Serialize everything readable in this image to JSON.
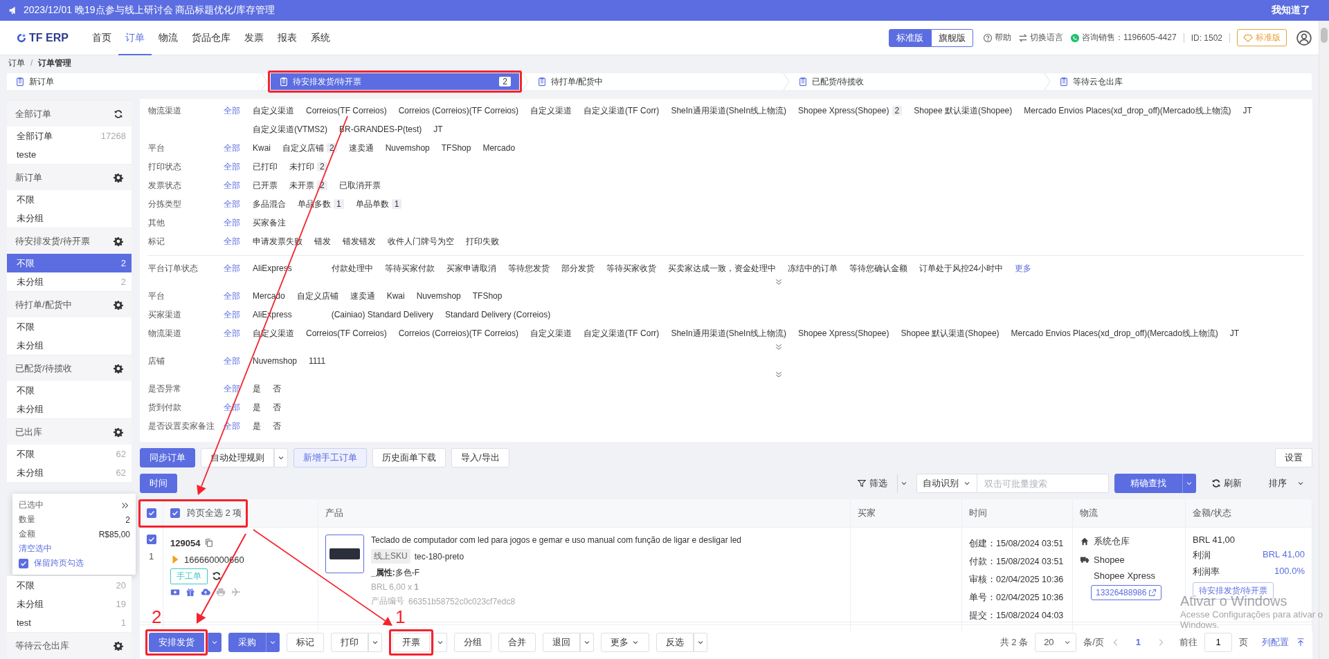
{
  "announcement": {
    "text": "2023/12/01 晚19点参与线上研讨会 商品标题优化/库存管理",
    "dismiss": "我知道了"
  },
  "nav": {
    "logo": "TF ERP",
    "items": [
      {
        "label": "首页",
        "selected": false
      },
      {
        "label": "订单",
        "selected": true
      },
      {
        "label": "物流",
        "selected": false
      },
      {
        "label": "货品仓库",
        "selected": false
      },
      {
        "label": "发票",
        "selected": false
      },
      {
        "label": "报表",
        "selected": false
      },
      {
        "label": "系统",
        "selected": false
      }
    ],
    "editions": [
      {
        "label": "标准版",
        "selected": true
      },
      {
        "label": "旗舰版",
        "selected": false
      }
    ],
    "help": "帮助",
    "language": "切换语言",
    "consult": "咨询销售：1196605-4427",
    "account_id": "ID: 1502",
    "plan": "标准版"
  },
  "breadcrumb": {
    "items": [
      "订单",
      "订单管理"
    ],
    "separator": "/"
  },
  "steps": [
    {
      "label": "新订单",
      "selected": false,
      "highlighted": false
    },
    {
      "label": "待安排发货/待开票",
      "count": "2",
      "selected": true,
      "highlighted": true
    },
    {
      "label": "待打单/配货中",
      "selected": false,
      "highlighted": false
    },
    {
      "label": "已配货/待揽收",
      "selected": false,
      "highlighted": false
    },
    {
      "label": "等待云仓出库",
      "selected": false,
      "highlighted": false
    }
  ],
  "sidebar": {
    "groups": [
      {
        "kind": "all",
        "title": "全部订单",
        "items": [
          {
            "label": "全部订单",
            "count": "17268",
            "selected": false
          },
          {
            "label": "teste",
            "selected": false
          }
        ]
      },
      {
        "kind": "status",
        "title": "新订单",
        "items": [
          {
            "label": "不限",
            "selected": false
          },
          {
            "label": "未分组",
            "selected": false
          }
        ]
      },
      {
        "kind": "status",
        "title": "待安排发货/待开票",
        "items": [
          {
            "label": "不限",
            "count": "2",
            "selected": true
          },
          {
            "label": "未分组",
            "count": "2",
            "selected": false
          }
        ]
      },
      {
        "kind": "status",
        "title": "待打单/配货中",
        "items": [
          {
            "label": "不限",
            "selected": false
          },
          {
            "label": "未分组",
            "selected": false
          }
        ]
      },
      {
        "kind": "status",
        "title": "已配货/待揽收",
        "items": [
          {
            "label": "不限",
            "selected": false
          },
          {
            "label": "未分组",
            "selected": false
          }
        ]
      },
      {
        "kind": "status",
        "title": "已出库",
        "items": [
          {
            "label": "不限",
            "count": "62",
            "selected": false
          },
          {
            "label": "未分组",
            "count": "62",
            "selected": false
          }
        ]
      },
      {
        "kind": "selection",
        "title": "已选中",
        "rows": [
          {
            "label": "数量",
            "value": "2"
          },
          {
            "label": "金额",
            "value": "R$85,00"
          }
        ],
        "clear": "清空选中",
        "keep": {
          "label": "保留跨页勾选",
          "checked": true
        }
      },
      {
        "kind": "status",
        "items": [
          {
            "label": "不限",
            "count": "20",
            "selected": false
          },
          {
            "label": "未分组",
            "count": "19",
            "selected": false
          },
          {
            "label": "test",
            "count": "1",
            "selected": false
          }
        ]
      },
      {
        "kind": "status",
        "title": "等待云仓出库"
      }
    ]
  },
  "filters": {
    "sections": [
      {
        "rows": [
          {
            "label": "物流渠道",
            "all": "全部",
            "options": [
              {
                "label": "自定义渠道"
              },
              {
                "label": "Correios(TF Correios)"
              },
              {
                "label": "Correios (Correios)(TF Correios)"
              },
              {
                "label": "自定义渠道"
              },
              {
                "label": "自定义渠道(TF Corr)"
              },
              {
                "label": "SheIn通用渠道(SheIn线上物流)"
              },
              {
                "label": "Shopee Xpress(Shopee)",
                "count": "2"
              },
              {
                "label": "Shopee 默认渠道(Shopee)"
              },
              {
                "label": "Mercado Envios Places(xd_drop_off)(Mercado线上物流)"
              },
              {
                "label": "JT"
              },
              {
                "label": "自定义渠道(VTMS2)"
              },
              {
                "label": "BR-GRANDES-P(test)"
              },
              {
                "label": "JT"
              }
            ]
          },
          {
            "label": "平台",
            "all": "全部",
            "options": [
              {
                "label": "Kwai"
              },
              {
                "label": "自定义店铺",
                "count": "2"
              },
              {
                "label": "速卖通"
              },
              {
                "label": "Nuvemshop"
              },
              {
                "label": "TFShop"
              },
              {
                "label": "Mercado"
              }
            ]
          },
          {
            "label": "打印状态",
            "all": "全部",
            "options": [
              {
                "label": "已打印"
              },
              {
                "label": "未打印",
                "count": "2"
              }
            ]
          },
          {
            "label": "发票状态",
            "all": "全部",
            "options": [
              {
                "label": "已开票"
              },
              {
                "label": "未开票",
                "count": "2"
              },
              {
                "label": "已取消开票"
              }
            ]
          },
          {
            "label": "分拣类型",
            "all": "全部",
            "options": [
              {
                "label": "多品混合"
              },
              {
                "label": "单品多数",
                "count": "1"
              },
              {
                "label": "单品单数",
                "count": "1"
              }
            ]
          },
          {
            "label": "其他",
            "all": "全部",
            "options": [
              {
                "label": "买家备注"
              }
            ]
          },
          {
            "label": "标记",
            "all": "全部",
            "options": [
              {
                "label": "申请发票失败"
              },
              {
                "label": "错发"
              },
              {
                "label": "错发错发"
              },
              {
                "label": "收件人门牌号为空"
              },
              {
                "label": "打印失败"
              }
            ]
          }
        ]
      },
      {
        "rows": [
          {
            "label": "平台订单状态",
            "all": "全部",
            "expandable": true,
            "more": "更多",
            "options": [
              {
                "label": "AliExpress",
                "kind": "group"
              },
              {
                "label": "付款处理中",
                "kind": "option"
              },
              {
                "label": "等待买家付款",
                "kind": "option"
              },
              {
                "label": "买家申请取消",
                "kind": "option"
              },
              {
                "label": "等待您发货",
                "kind": "option"
              },
              {
                "label": "部分发货",
                "kind": "option"
              },
              {
                "label": "等待买家收货",
                "kind": "option"
              },
              {
                "label": "买卖家达成一致，资金处理中",
                "kind": "option"
              },
              {
                "label": "冻结中的订单",
                "kind": "option"
              },
              {
                "label": "等待您确认金额",
                "kind": "option"
              },
              {
                "label": "订单处于风控24小时中",
                "kind": "option"
              }
            ]
          },
          {
            "label": "平台",
            "all": "全部",
            "expandable": false,
            "options": [
              {
                "label": "Mercado"
              },
              {
                "label": "自定义店铺"
              },
              {
                "label": "速卖通"
              },
              {
                "label": "Kwai"
              },
              {
                "label": "Nuvemshop"
              },
              {
                "label": "TFShop"
              }
            ]
          },
          {
            "label": "买家渠道",
            "all": "全部",
            "expandable": false,
            "options": [
              {
                "label": "AliExpress",
                "kind": "group"
              },
              {
                "label": "(Cainiao) Standard Delivery",
                "kind": "option"
              },
              {
                "label": "Standard Delivery (Correios)",
                "kind": "option"
              }
            ]
          },
          {
            "label": "物流渠道",
            "all": "全部",
            "expandable": true,
            "options": [
              {
                "label": "自定义渠道"
              },
              {
                "label": "Correios(TF Correios)"
              },
              {
                "label": "Correios (Correios)(TF Correios)"
              },
              {
                "label": "自定义渠道"
              },
              {
                "label": "自定义渠道(TF Corr)"
              },
              {
                "label": "SheIn通用渠道(SheIn线上物流)"
              },
              {
                "label": "Shopee Xpress(Shopee)"
              },
              {
                "label": "Shopee 默认渠道(Shopee)"
              },
              {
                "label": "Mercado Envios Places(xd_drop_off)(Mercado线上物流)"
              },
              {
                "label": "JT"
              }
            ]
          },
          {
            "label": "店铺",
            "all": "全部",
            "expandable": true,
            "options": [
              {
                "label": "Nuvemshop"
              },
              {
                "label": "1111"
              }
            ]
          },
          {
            "label": "是否异常",
            "all": "全部",
            "expandable": false,
            "options": [
              {
                "label": "是"
              },
              {
                "label": "否"
              }
            ]
          },
          {
            "label": "货到付款",
            "all": "全部",
            "expandable": false,
            "options": [
              {
                "label": "是"
              },
              {
                "label": "否"
              }
            ]
          },
          {
            "label": "是否设置卖家备注",
            "all": "全部",
            "expandable": false,
            "options": [
              {
                "label": "是"
              },
              {
                "label": "否"
              }
            ]
          }
        ]
      }
    ]
  },
  "toolbar": {
    "left": [
      {
        "label": "同步订单",
        "kind": "primary",
        "split": false
      },
      {
        "label": "自动处理规则",
        "kind": "default",
        "split": true
      },
      {
        "label": "新增手工订单",
        "kind": "light",
        "split": false
      },
      {
        "label": "历史面单下载",
        "kind": "default",
        "split": false
      },
      {
        "label": "导入/导出",
        "kind": "default",
        "split": false
      }
    ],
    "right": [
      {
        "label": "设置",
        "kind": "default",
        "split": false
      }
    ]
  },
  "searchbar": {
    "left": [
      {
        "label": "时间",
        "kind": "primary",
        "split": false
      }
    ],
    "filter": "筛选",
    "mode": "自动识别",
    "placeholder": "双击可批量搜索",
    "exact": "精确查找",
    "refresh": "刷新",
    "sort": "排序"
  },
  "table": {
    "header_checked": true,
    "select_all": {
      "checked": true,
      "label": "跨页全选 2 项",
      "highlighted": true
    },
    "columns": [
      "产品",
      "买家",
      "时间",
      "物流",
      "金额/状态"
    ],
    "rows": [
      {
        "checked": true,
        "index": "1",
        "order_no": "129054",
        "platform_order": "166660000660",
        "tag": "手工单",
        "product": {
          "title": "Teclado de computador com led para jogos e gemar e uso manual com função de ligar e desligar led",
          "sku_label": "线上SKU",
          "sku": "tec-180-preto",
          "attribute": "**_属性:**多色-F",
          "price": "BRL 6,00 x **1**",
          "code_label": "产品编号",
          "code": "66351b58752c0c023cf7edc8"
        },
        "times": [
          "创建：15/08/2024 03:51",
          "付款：15/08/2024 03:51",
          "审核：02/04/2025 10:36",
          "单号：02/04/2025 10:36",
          "提交：15/08/2024 04:03"
        ],
        "logistics": {
          "warehouse": "系统仓库",
          "carrier": "Shopee",
          "service": "Shopee Xpress",
          "tracking": "13326488986"
        },
        "amount": {
          "total": "BRL 41,00",
          "profit_label": "利润",
          "profit": "BRL 41,00",
          "rate_label": "利润率",
          "rate": "100.0%",
          "status": "待安排发货/待开票"
        }
      }
    ]
  },
  "actions": [
    {
      "label": "安排发货",
      "kind": "primary",
      "split": true,
      "caret": false,
      "highlighted": true,
      "step": "2"
    },
    {
      "label": "采购",
      "kind": "primary",
      "split": true,
      "caret": false,
      "highlighted": false
    },
    {
      "label": "标记",
      "kind": "default",
      "split": false,
      "caret": false,
      "highlighted": false
    },
    {
      "label": "打印",
      "kind": "default",
      "split": true,
      "caret": false,
      "highlighted": false
    },
    {
      "label": "开票",
      "kind": "default",
      "split": true,
      "caret": false,
      "highlighted": true,
      "step": "1"
    },
    {
      "label": "分组",
      "kind": "default",
      "split": false,
      "caret": false,
      "highlighted": false
    },
    {
      "label": "合并",
      "kind": "default",
      "split": false,
      "caret": false,
      "highlighted": false
    },
    {
      "label": "退回",
      "kind": "default",
      "split": true,
      "caret": false,
      "highlighted": false
    },
    {
      "label": "更多",
      "kind": "default",
      "split": false,
      "caret": true,
      "highlighted": false
    },
    {
      "label": "反选",
      "kind": "default",
      "split": true,
      "caret": false,
      "highlighted": false
    }
  ],
  "pagination": {
    "total": "共 2 条",
    "page_size": "20",
    "per_page": "条/页",
    "pages": [
      {
        "label": "1",
        "selected": true
      }
    ],
    "goto_label": "前往",
    "goto_value": "1",
    "goto_suffix": "页",
    "columns_link": "列配置"
  },
  "os_notice": {
    "title": "Ativar o Windows",
    "subtitle": "Acesse Configurações para ativar o Windows."
  }
}
